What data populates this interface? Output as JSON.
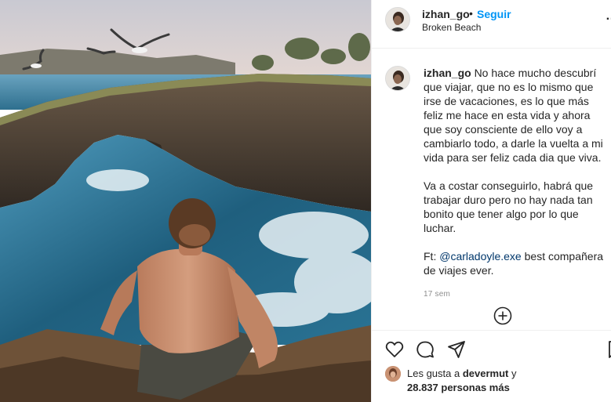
{
  "post": {
    "photo_alt": "photo",
    "username": "izhan_go",
    "separator": "•",
    "follow_label": "Seguir",
    "location": "Broken Beach",
    "more_icon": "…"
  },
  "caption": {
    "username": "izhan_go",
    "paragraph1": "No hace mucho descubrí que viajar, que no es lo mismo que irse de vacaciones, es lo que más feliz me hace en esta vida y ahora que soy consciente de ello voy a cambiarlo todo, a darle la vuelta a mi vida para ser feliz cada dia que viva.",
    "paragraph2": "Va a costar conseguirlo, habrá que trabajar duro pero no hay nada tan bonito que tener algo por lo que luchar.",
    "paragraph3_prefix": "Ft: ",
    "mention": "@carladoyle.exe",
    "paragraph3_suffix": " best compañera de viajes ever.",
    "age": "17 sem"
  },
  "actions": {
    "like_icon": "heart-icon",
    "comment_icon": "comment-icon",
    "share_icon": "paper-plane-icon",
    "save_icon": "bookmark-icon",
    "load_more_icon": "plus-circle-icon"
  },
  "likes": {
    "prefix": "Les gusta a ",
    "user": "devermut",
    "middle": " y",
    "count": "28.837 personas más"
  },
  "colors": {
    "link_blue": "#0095f6",
    "mention_blue": "#00376b",
    "text": "#262626",
    "muted": "#8e8e8e",
    "border": "#efefef"
  }
}
